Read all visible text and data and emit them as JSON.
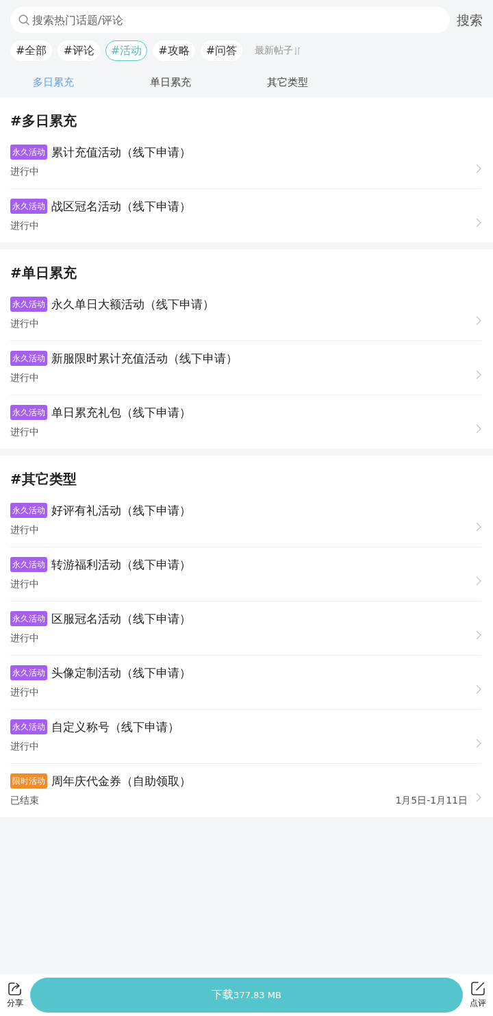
{
  "search": {
    "placeholder": "搜索热门话题/评论",
    "button": "搜索"
  },
  "topics": [
    {
      "label": "#全部",
      "selected": false
    },
    {
      "label": "#评论",
      "selected": false
    },
    {
      "label": "#活动",
      "selected": true
    },
    {
      "label": "#攻略",
      "selected": false
    },
    {
      "label": "#问答",
      "selected": false
    }
  ],
  "sort": {
    "label": "最新帖子"
  },
  "sub_tabs": [
    {
      "label": "多日累充",
      "selected": true
    },
    {
      "label": "单日累充",
      "selected": false
    },
    {
      "label": "其它类型",
      "selected": false
    }
  ],
  "sections": [
    {
      "title": "#多日累充",
      "items": [
        {
          "badge": "永久活动",
          "color": "#a55ef0",
          "title": "累计充值活动（线下申请）",
          "status": "进行中"
        },
        {
          "badge": "永久活动",
          "color": "#a55ef0",
          "title": "战区冠名活动（线下申请）",
          "status": "进行中"
        }
      ]
    },
    {
      "title": "#单日累充",
      "items": [
        {
          "badge": "永久活动",
          "color": "#a55ef0",
          "title": "永久单日大额活动（线下申请）",
          "status": "进行中"
        },
        {
          "badge": "永久活动",
          "color": "#a55ef0",
          "title": "新服限时累计充值活动（线下申请）",
          "status": "进行中"
        },
        {
          "badge": "永久活动",
          "color": "#a55ef0",
          "title": "单日累充礼包（线下申请）",
          "status": "进行中"
        }
      ]
    },
    {
      "title": "#其它类型",
      "items": [
        {
          "badge": "永久活动",
          "color": "#a55ef0",
          "title": "好评有礼活动（线下申请）",
          "status": "进行中"
        },
        {
          "badge": "永久活动",
          "color": "#a55ef0",
          "title": "转游福利活动（线下申请）",
          "status": "进行中"
        },
        {
          "badge": "永久活动",
          "color": "#a55ef0",
          "title": "区服冠名活动（线下申请）",
          "status": "进行中"
        },
        {
          "badge": "永久活动",
          "color": "#a55ef0",
          "title": "头像定制活动（线下申请）",
          "status": "进行中"
        },
        {
          "badge": "永久活动",
          "color": "#a55ef0",
          "title": "自定义称号（线下申请）",
          "status": "进行中"
        },
        {
          "badge": "限时活动",
          "color": "#f08c2a",
          "title": "周年庆代金券（自助领取）",
          "status": "已结束",
          "date": "1月5日-1月11日"
        }
      ]
    }
  ],
  "bottom_bar": {
    "share": "分享",
    "download": {
      "label": "下载",
      "size": "377.83 MB"
    },
    "review": "点评"
  }
}
